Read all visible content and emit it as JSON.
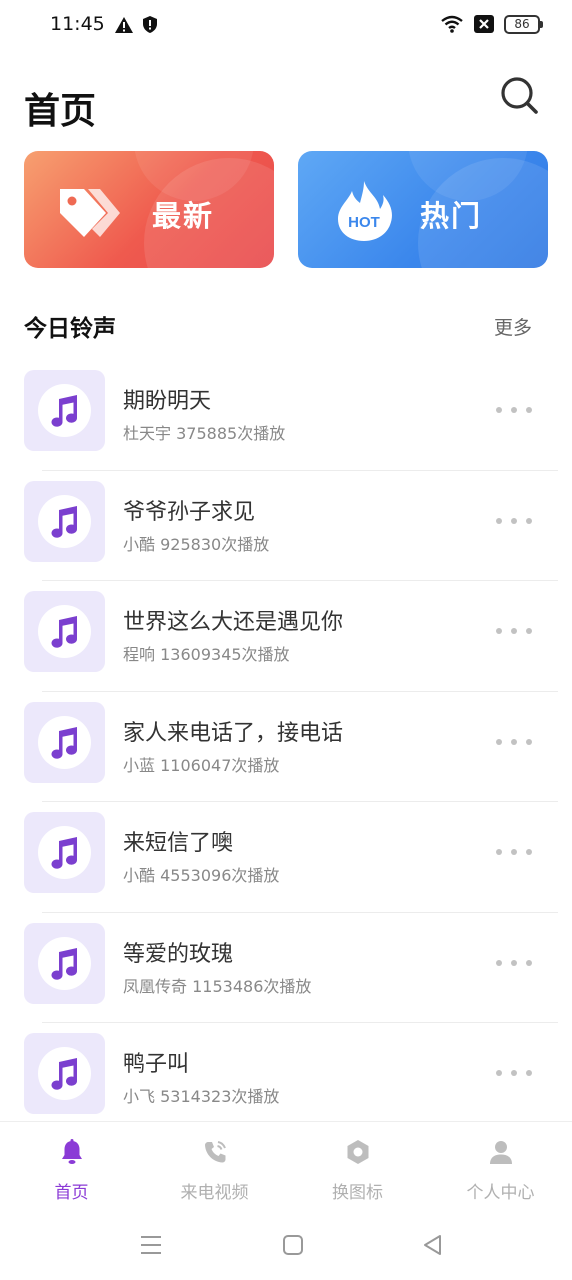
{
  "status_bar": {
    "time": "11:45",
    "battery": "86",
    "icons": [
      "warning-icon",
      "shield-icon",
      "wifi-icon",
      "signal-off-icon",
      "battery-icon"
    ]
  },
  "header": {
    "title": "首页",
    "search_icon": "search-icon"
  },
  "banners": [
    {
      "label": "最新",
      "icon": "tags-icon",
      "color": "#ef5a4e"
    },
    {
      "label": "热门",
      "icon": "hot-flame-icon",
      "badge": "HOT",
      "color": "#3b87ec"
    }
  ],
  "section": {
    "title": "今日铃声",
    "more": "更多"
  },
  "ringtones": [
    {
      "title": "期盼明天",
      "artist": "杜天宇",
      "plays": "375885次播放"
    },
    {
      "title": "爷爷孙子求见",
      "artist": "小酷",
      "plays": "925830次播放"
    },
    {
      "title": "世界这么大还是遇见你",
      "artist": "程响",
      "plays": "13609345次播放"
    },
    {
      "title": "家人来电话了，接电话",
      "artist": "小蓝",
      "plays": "1106047次播放"
    },
    {
      "title": "来短信了噢",
      "artist": "小酷",
      "plays": "4553096次播放"
    },
    {
      "title": "等爱的玫瑰",
      "artist": "凤凰传奇",
      "plays": "1153486次播放"
    },
    {
      "title": "鸭子叫",
      "artist": "小飞",
      "plays": "5314323次播放"
    }
  ],
  "bottom_nav": [
    {
      "label": "首页",
      "icon": "bell-icon",
      "active": true
    },
    {
      "label": "来电视频",
      "icon": "phone-icon",
      "active": false
    },
    {
      "label": "换图标",
      "icon": "hexagon-icon",
      "active": false
    },
    {
      "label": "个人中心",
      "icon": "person-icon",
      "active": false
    }
  ],
  "colors": {
    "accent": "#8b3bd6",
    "cover_bg": "#ece8fb",
    "music_note": "#7b3fcf"
  }
}
